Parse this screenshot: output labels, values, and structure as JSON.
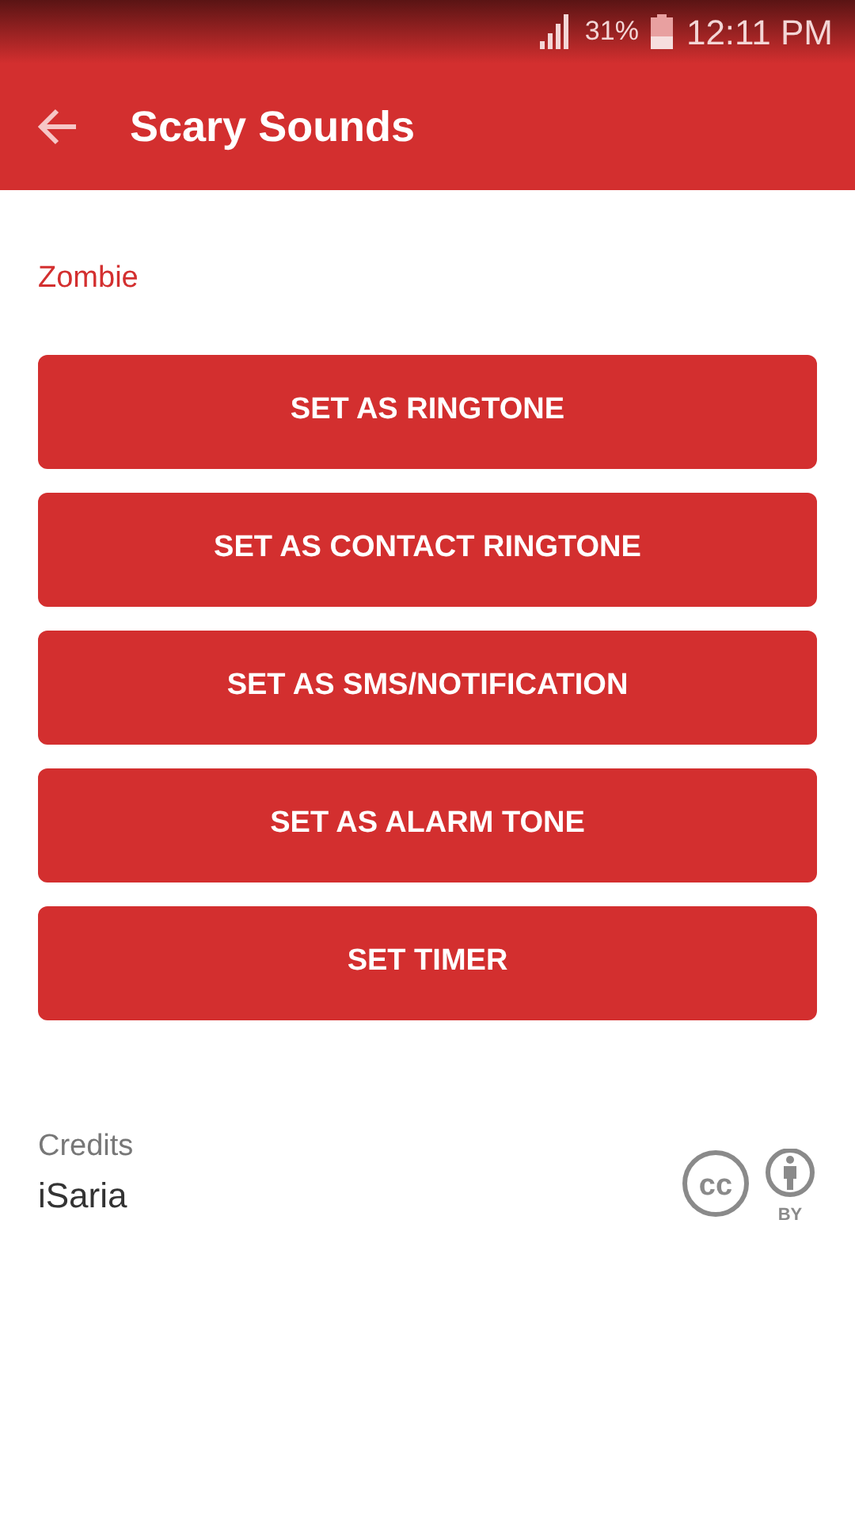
{
  "status_bar": {
    "battery": "31%",
    "time": "12:11 PM"
  },
  "app_bar": {
    "title": "Scary Sounds"
  },
  "sound_name": "Zombie",
  "buttons": [
    "SET AS RINGTONE",
    "SET AS CONTACT RINGTONE",
    "SET AS SMS/NOTIFICATION",
    "SET AS ALARM TONE",
    "SET TIMER"
  ],
  "credits": {
    "label": "Credits",
    "author": "iSaria",
    "license_cc": "cc",
    "license_by": "BY"
  }
}
